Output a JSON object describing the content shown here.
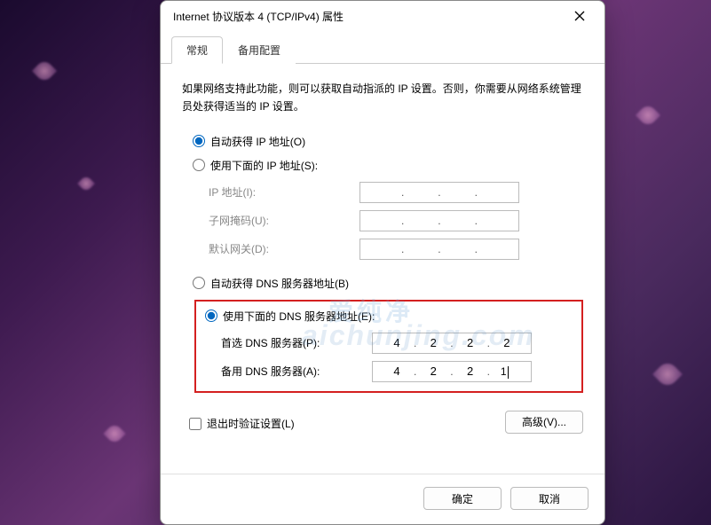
{
  "dialog": {
    "title": "Internet 协议版本 4 (TCP/IPv4) 属性"
  },
  "tabs": {
    "general": "常规",
    "alternate": "备用配置"
  },
  "description": "如果网络支持此功能，则可以获取自动指派的 IP 设置。否则，你需要从网络系统管理员处获得适当的 IP 设置。",
  "ipSection": {
    "radioAuto": "自动获得 IP 地址(O)",
    "radioManual": "使用下面的 IP 地址(S):",
    "ipLabel": "IP 地址(I):",
    "subnetLabel": "子网掩码(U):",
    "gatewayLabel": "默认网关(D):"
  },
  "dnsSection": {
    "radioAuto": "自动获得 DNS 服务器地址(B)",
    "radioManual": "使用下面的 DNS 服务器地址(E):",
    "preferredLabel": "首选 DNS 服务器(P):",
    "alternateLabel": "备用 DNS 服务器(A):",
    "preferred": {
      "o1": "4",
      "o2": "2",
      "o3": "2",
      "o4": "2"
    },
    "alternate": {
      "o1": "4",
      "o2": "2",
      "o3": "2",
      "o4": "1"
    }
  },
  "validateCheckbox": "退出时验证设置(L)",
  "advancedBtn": "高级(V)...",
  "footer": {
    "ok": "确定",
    "cancel": "取消"
  },
  "watermark": {
    "cn": "爱纯净",
    "en": "aichunjing.com"
  }
}
